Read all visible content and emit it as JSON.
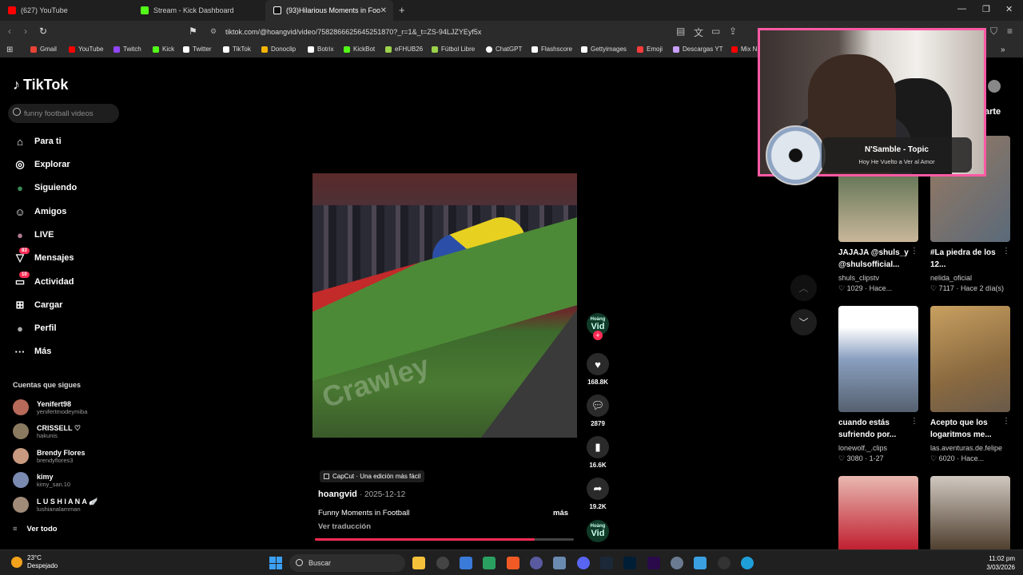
{
  "tabs": [
    {
      "label": "(627) YouTube",
      "color": "#ff0000"
    },
    {
      "label": "Stream - Kick Dashboard",
      "color": "#53fc18"
    },
    {
      "label": "(93)Hilarious Moments in Foo",
      "color": "#ffffff"
    }
  ],
  "address": {
    "url": "tiktok.com/@hoangvid/video/7582866625645251870?_r=1&_t=ZS-94LJZYEyf5x"
  },
  "bookmarks": [
    {
      "label": "Gmail",
      "color": "#ea4335"
    },
    {
      "label": "YouTube",
      "color": "#ff0000"
    },
    {
      "label": "Twitch",
      "color": "#9146ff"
    },
    {
      "label": "Kick",
      "color": "#53fc18"
    },
    {
      "label": "Twitter",
      "color": "#ffffff"
    },
    {
      "label": "TikTok",
      "color": "#ffffff"
    },
    {
      "label": "Donoclip",
      "color": "#f4b400"
    },
    {
      "label": "Botrix",
      "color": "#ffffff"
    },
    {
      "label": "KickBot",
      "color": "#53fc18"
    },
    {
      "label": "eFHUB26",
      "color": "#9bd34a"
    },
    {
      "label": "Fútbol Libre",
      "color": "#9bd34a"
    },
    {
      "label": "ChatGPT",
      "color": "#ffffff"
    },
    {
      "label": "Flashscore",
      "color": "#ffffff"
    },
    {
      "label": "Gettyimages",
      "color": "#ffffff"
    },
    {
      "label": "Emoji",
      "color": "#ff3b3b"
    },
    {
      "label": "Descargas YT",
      "color": "#c9a0ff"
    },
    {
      "label": "Mix N",
      "color": "#ff0000"
    }
  ],
  "sidebar": {
    "logo": "TikTok",
    "search_placeholder": "funny football videos",
    "nav": [
      {
        "label": "Para ti",
        "icon": "home-icon",
        "glyph": "⌂"
      },
      {
        "label": "Explorar",
        "icon": "compass-icon",
        "glyph": "◎"
      },
      {
        "label": "Siguiendo",
        "icon": "following-icon",
        "glyph": "●"
      },
      {
        "label": "Amigos",
        "icon": "friends-icon",
        "glyph": "☺"
      },
      {
        "label": "LIVE",
        "icon": "live-icon",
        "glyph": "●"
      },
      {
        "label": "Mensajes",
        "icon": "messages-icon",
        "glyph": "▽",
        "badge": "83"
      },
      {
        "label": "Actividad",
        "icon": "activity-icon",
        "glyph": "▭",
        "badge": "10"
      },
      {
        "label": "Cargar",
        "icon": "upload-icon",
        "glyph": "⊞"
      },
      {
        "label": "Perfil",
        "icon": "profile-icon",
        "glyph": "●"
      },
      {
        "label": "Más",
        "icon": "more-icon",
        "glyph": "···"
      }
    ],
    "following_title": "Cuentas que sigues",
    "accounts": [
      {
        "name": "Yenifert98",
        "handle": "yenifertmodeymiba",
        "color": "#b86a5a"
      },
      {
        "name": "CRISSELL ♡",
        "handle": "hakunis",
        "color": "#8a7a60"
      },
      {
        "name": "Brendy Flores",
        "handle": "brendyflores3",
        "color": "#c89a80"
      },
      {
        "name": "kimy",
        "handle": "kimy_san.10",
        "color": "#7a8ab0"
      },
      {
        "name": "L U S H I A N A 🪽",
        "handle": "lushianalamman",
        "color": "#a08a78"
      }
    ],
    "see_all": "Ver todo"
  },
  "video": {
    "capcut": "CapCut · Una edición más fácil",
    "author": "hoangvid",
    "date": "· 2025-12-12",
    "description": "Funny Moments in Football",
    "more": "más",
    "translate": "Ver traducción",
    "watermark": "Crawley",
    "progress": 0.85,
    "avatar_line1": "Hoàng",
    "avatar_line2": "Vid"
  },
  "actions": {
    "likes": "168.8K",
    "comments": "2879",
    "saves": "16.6K",
    "shares": "19.2K"
  },
  "right": {
    "share_label": "arte",
    "cards": [
      {
        "title": "JAJAJA @shuls_y @shulsofficial...",
        "user": "shuls_clipstv",
        "likes": "1029",
        "when": "Hace...",
        "colors": [
          "#3a5a3a",
          "#c9b79a"
        ]
      },
      {
        "title": "#La piedra de los 12...",
        "user": "nelida_oficial",
        "likes": "7117",
        "when": "Hace 2 día(s)",
        "colors": [
          "#9a7a60",
          "#5a6a7a"
        ]
      },
      {
        "title": "cuando estás sufriendo por...",
        "user": "lonewolf._.clips",
        "likes": "3080",
        "when": "1-27",
        "colors": [
          "#ffffff",
          "#8aa0c0"
        ]
      },
      {
        "title": "Acepto que los logaritmos me...",
        "user": "las.aventuras.de.felipe",
        "likes": "6020",
        "when": "Hace...",
        "colors": [
          "#c8a060",
          "#8a6a40"
        ]
      },
      {
        "title": "",
        "user": "",
        "likes": "",
        "when": "",
        "colors": [
          "#e8b8b0",
          "#c02030"
        ]
      },
      {
        "title": "",
        "user": "",
        "likes": "",
        "when": "",
        "colors": [
          "#d0c8c0",
          "#504030"
        ]
      }
    ]
  },
  "overlay": {
    "music_title": "N'Samble - Topic",
    "music_subtitle": "Hoy He Vuelto a Ver al Amor"
  },
  "taskbar": {
    "temp": "23°C",
    "weather": "Despejado",
    "search": "Buscar",
    "time": "11:02 pm",
    "date": "3/03/2026"
  }
}
